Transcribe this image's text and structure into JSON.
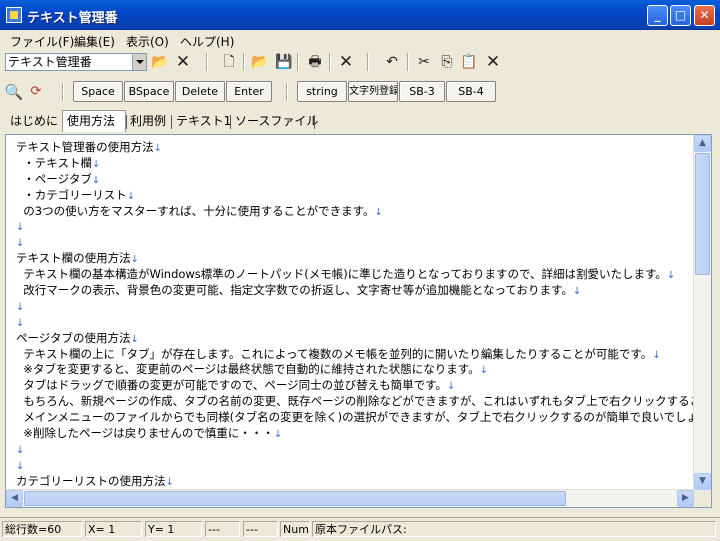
{
  "window": {
    "title": "テキスト管理番"
  },
  "menu": [
    "ファイル(F)",
    "編集(E)",
    "表示(O)",
    "ヘルプ(H)"
  ],
  "combo": {
    "value": "テキスト管理番"
  },
  "buttons": [
    "Space",
    "BSpace",
    "Delete",
    "Enter",
    "string",
    "文字列登録",
    "SB-3",
    "SB-4"
  ],
  "tabs": [
    "はじめに",
    "使用方法",
    "利用例",
    "テキスト1",
    "ソースファイル"
  ],
  "active_tab": "使用方法",
  "lines": [
    "テキスト管理番の使用方法",
    "  ・テキスト欄",
    "  ・ページタブ",
    "  ・カテゴリーリスト",
    "  の3つの使い方をマスターすれば、十分に使用することができます。",
    "",
    "",
    "テキスト欄の使用方法",
    "  テキスト欄の基本構造がWindows標準のノートパッド(メモ帳)に準じた造りとなっておりますので、詳細は割愛いたします。",
    "  改行マークの表示、背景色の変更可能、指定文字数での折返し、文字寄せ等が追加機能となっております。",
    "",
    "",
    "ページタブの使用方法",
    "  テキスト欄の上に「タブ」が存在します。これによって複数のメモ帳を並列的に開いたり編集したりすることが可能です。",
    "  ※タブを変更すると、変更前のページは最終状態で自動的に維持された状態になります。",
    "  タブはドラッグで順番の変更が可能ですので、ページ同士の並び替えも簡単です。",
    "  もちろん、新規ページの作成、タブの名前の変更、既存ページの削除などができますが、これはいずれもタブ上で右クリックすることで",
    "  メインメニューのファイルからでも同様(タブ名の変更を除く)の選択ができますが、タブ上で右クリックするのが簡単で良いでしょう。",
    "  ※削除したページは戻りませんので慎重に・・・",
    "",
    "",
    "カテゴリーリストの使用方法"
  ],
  "line_marks": [
    true,
    true,
    true,
    true,
    true,
    true,
    true,
    true,
    true,
    true,
    true,
    true,
    true,
    true,
    true,
    true,
    false,
    true,
    true,
    true,
    true,
    true
  ],
  "return_mark": "↓",
  "status": {
    "total_lines": "総行数=60",
    "x": "X= 1",
    "y": "Y= 1",
    "f1": "---",
    "f2": "---",
    "num": "Num",
    "path": "原本ファイルパス:"
  },
  "colors": {
    "title_bar": "#0a5fd8",
    "return_mark": "#3a6fd8"
  }
}
